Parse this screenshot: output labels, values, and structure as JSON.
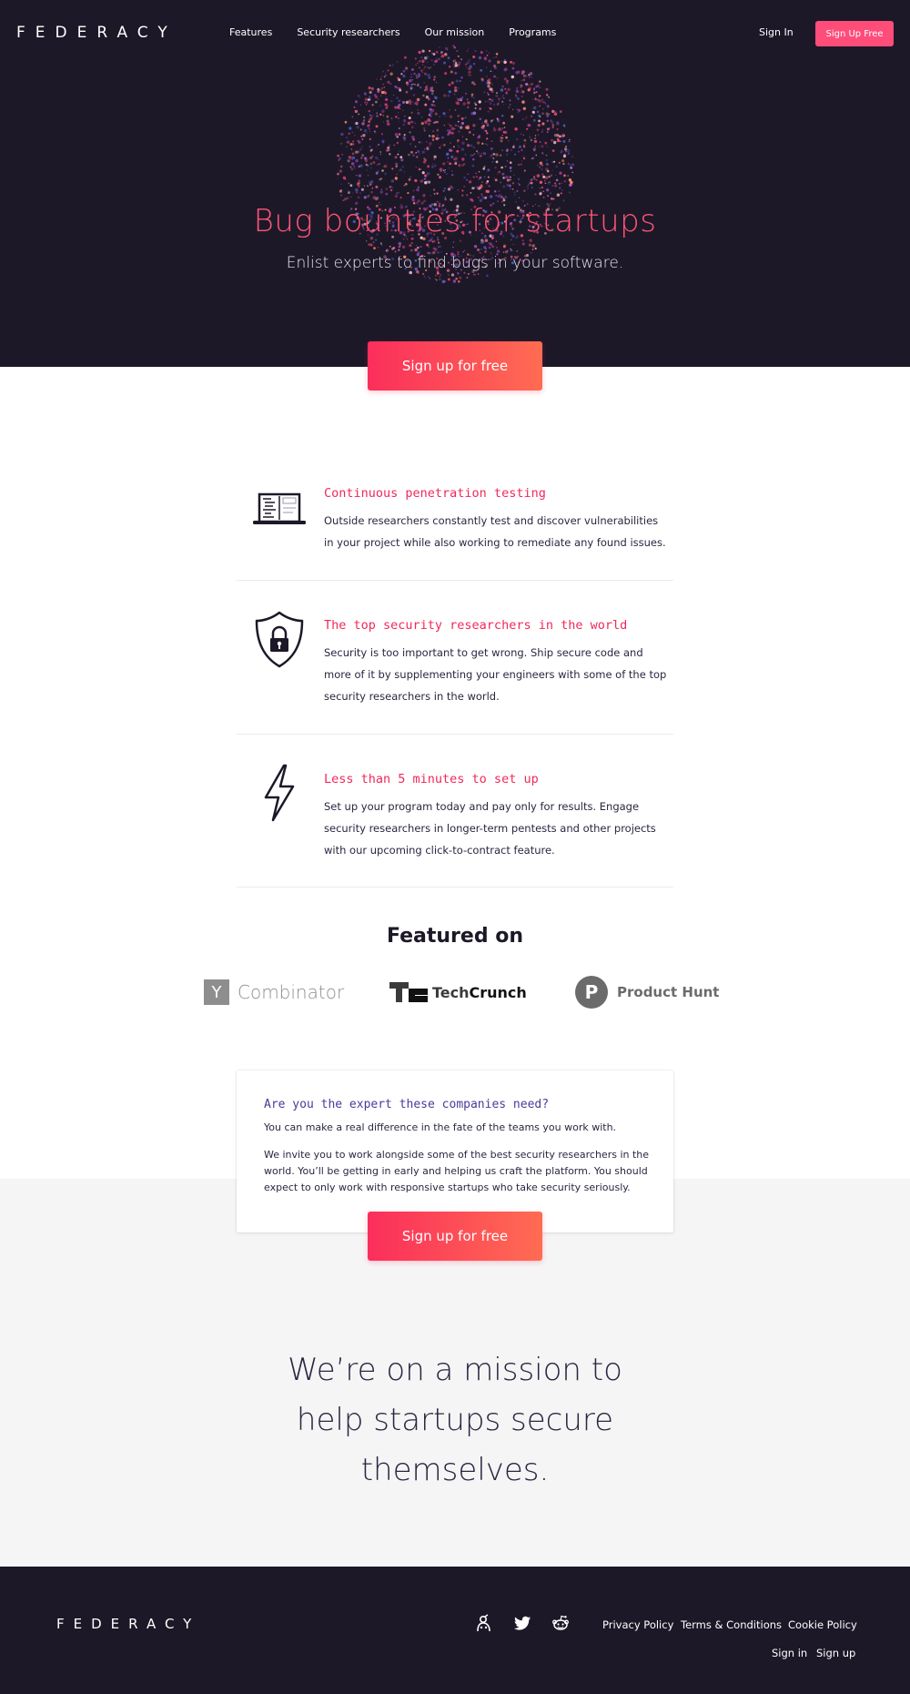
{
  "header": {
    "logo": "FEDERACY",
    "nav": [
      "Features",
      "Security researchers",
      "Our mission",
      "Programs"
    ],
    "sign_in": "Sign In",
    "sign_up": "Sign Up Free"
  },
  "hero": {
    "title": "Bug bounties for startups",
    "subtitle": "Enlist experts to find bugs in your software.",
    "cta": "Sign up for free"
  },
  "features": [
    {
      "icon": "laptop-icon",
      "title": "Continuous penetration testing",
      "body": "Outside researchers constantly test and discover vulnerabilities in your project while also working to remediate any found issues."
    },
    {
      "icon": "shield-lock-icon",
      "title": "The top security researchers in the world",
      "body": "Security is too important to get wrong. Ship secure code and more of it by supplementing your engineers with some of the top security researchers in the world."
    },
    {
      "icon": "lightning-icon",
      "title": "Less than 5 minutes to set up",
      "body": "Set up your program today and pay only for results. Engage security researchers in longer-term pentests and other projects with our upcoming click-to-contract feature."
    }
  ],
  "featured_on": {
    "title": "Featured on",
    "yc_letter": "Y",
    "yc_name": "Combinator",
    "tc_tech": "Tech",
    "tc_crunch": "Crunch",
    "ph_letter": "P",
    "ph_name": "Product Hunt"
  },
  "expert": {
    "title": "Are you the expert these companies need?",
    "p1": "You can make a real difference in the fate of the teams you work with.",
    "p2": "We invite you to work alongside some of the best security researchers in the world. You’ll be getting in early and helping us craft the platform. You should expect to only work with responsive startups who take security seriously.",
    "cta": "Sign up for free"
  },
  "mission": "We’re on a mission to help startups secure themselves.",
  "footer": {
    "logo": "FEDERACY",
    "social": [
      "keybase-icon",
      "twitter-icon",
      "reddit-icon"
    ],
    "links": [
      "Privacy Policy",
      "Terms & Conditions",
      "Cookie Policy"
    ],
    "sign_in": "Sign in",
    "sign_up": "Sign up"
  },
  "colors": {
    "hero_bg": "#1d1828",
    "accent": "#ff4d7a",
    "cta_start": "#fb2e5b",
    "cta_end": "#ff6c52",
    "feature_title": "#f2285a",
    "expert_title": "#4b3a9a",
    "grey_bg": "#f5f5f6"
  }
}
